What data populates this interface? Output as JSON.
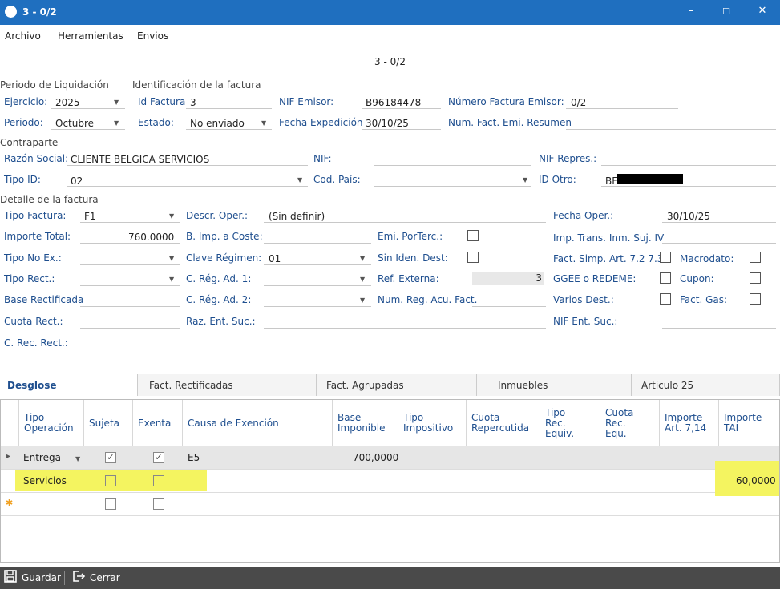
{
  "window": {
    "title": "3 - 0/2",
    "minimize": "–",
    "maximize": "☐",
    "close": "✕"
  },
  "menu": {
    "archivo": "Archivo",
    "herramientas": "Herramientas",
    "envios": "Envios"
  },
  "page_title": "3 - 0/2",
  "sections": {
    "periodo": "Periodo de Liquidación",
    "identificacion": "Identificación de la factura",
    "contraparte": "Contraparte",
    "detalle": "Detalle de la factura"
  },
  "form": {
    "ejercicio_label": "Ejercicio:",
    "ejercicio_value": "2025",
    "id_factura_label": "Id Factura",
    "id_factura_value": "3",
    "nif_emisor_label": "NIF Emisor:",
    "nif_emisor_value": "B96184478",
    "num_factura_emisor_label": "Número Factura Emisor:",
    "num_factura_emisor_value": "0/2",
    "periodo_label": "Periodo:",
    "periodo_value": "Octubre",
    "estado_label": "Estado:",
    "estado_value": "No enviado",
    "fecha_expedicion_label": "Fecha Expedición",
    "fecha_expedicion_value": "30/10/25",
    "num_fact_resumen_label": "Num. Fact. Emi. Resumen",
    "razon_social_label": "Razón Social:",
    "razon_social_value": "CLIENTE BELGICA SERVICIOS",
    "nif_label": "NIF:",
    "nif_repres_label": "NIF Repres.:",
    "tipo_id_label": "Tipo ID:",
    "tipo_id_value": "02",
    "cod_pais_label": "Cod. País:",
    "id_otro_label": "ID Otro:",
    "id_otro_value": "BE",
    "tipo_factura_label": "Tipo Factura:",
    "tipo_factura_value": "F1",
    "descr_oper_label": "Descr. Oper.:",
    "descr_oper_value": "(Sin definir)",
    "fecha_oper_label": "Fecha Oper.:",
    "fecha_oper_value": "30/10/25",
    "importe_total_label": "Importe Total:",
    "importe_total_value": "760.0000",
    "b_imp_coste_label": "B. Imp. a Coste:",
    "emi_porterc_label": "Emi. PorTerc.:",
    "imp_trans_label": "Imp. Trans. Inm. Suj. IV",
    "tipo_no_ex_label": "Tipo No Ex.:",
    "clave_regimen_label": "Clave Régimen:",
    "clave_regimen_value": "01",
    "sin_iden_dest_label": "Sin Iden. Dest:",
    "fact_simp_label": "Fact. Simp. Art. 7.2 7.3",
    "macrodato_label": "Macrodato:",
    "tipo_rect_label": "Tipo Rect.:",
    "c_reg_ad1_label": "C. Rég. Ad. 1:",
    "ref_externa_label": "Ref. Externa:",
    "ref_externa_value": "3",
    "ggee_label": "GGEE o REDEME:",
    "cupon_label": "Cupon:",
    "base_rect_label": "Base Rectificada",
    "c_reg_ad2_label": "C. Rég. Ad. 2:",
    "num_reg_acu_label": "Num. Reg. Acu. Fact.",
    "varios_dest_label": "Varios Dest.:",
    "fact_gas_label": "Fact. Gas:",
    "cuota_rect_label": "Cuota Rect.:",
    "raz_ent_suc_label": "Raz. Ent. Suc.:",
    "nif_ent_suc_label": "NIF Ent. Suc.:",
    "c_rec_rect_label": "C. Rec. Rect.:"
  },
  "tabs": [
    "Desglose",
    "Fact. Rectificadas",
    "Fact. Agrupadas",
    "Inmuebles",
    "Articulo 25"
  ],
  "grid": {
    "headers": [
      "Tipo\nOperación",
      "Sujeta",
      "Exenta",
      "Causa de Exención",
      "Base\nImponible",
      "Tipo\nImpositivo",
      "Cuota\nRepercutida",
      "Tipo\nRec.\nEquiv.",
      "Cuota\nRec.\nEqu.",
      "Importe\nArt. 7,14",
      "Importe\nTAI"
    ],
    "rows": [
      {
        "tipo": "Entrega",
        "sujeta": "✓",
        "exenta": "✓",
        "causa": "E5",
        "base": "700,0000",
        "tai": ""
      },
      {
        "tipo": "Servicios",
        "sujeta": "",
        "exenta": "",
        "causa": "",
        "base": "",
        "tai": "60,0000"
      }
    ],
    "new_row_marker": "✱",
    "row_pointer": "▸"
  },
  "footer": {
    "guardar": "Guardar",
    "cerrar": "Cerrar"
  },
  "colors": {
    "titlebar": "#1f6fbf",
    "label": "#1f4f8f",
    "highlight": "#f4f460",
    "footer": "#4a4a4a"
  }
}
